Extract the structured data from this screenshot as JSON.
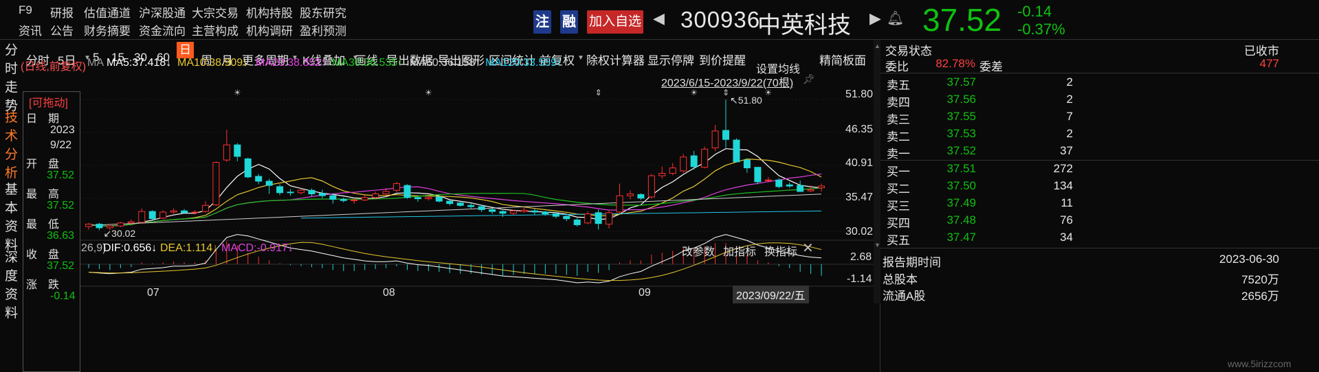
{
  "nav_row1": [
    "F9",
    "研报",
    "估值通道",
    "沪深股通",
    "大宗交易",
    "机构持股",
    "股东研究"
  ],
  "nav_row2": [
    "资讯",
    "公告",
    "财务摘要",
    "资金流向",
    "主营构成",
    "机构调研",
    "盈利预测"
  ],
  "header": {
    "zhu": "注",
    "rong": "融",
    "add_watch": "加入自选",
    "code": "300936",
    "name": "中英科技",
    "price": "37.52",
    "change": "-0.14",
    "change_pct": "-0.37%"
  },
  "toolbar": [
    "分时",
    "5日",
    "5",
    "15",
    "30",
    "60",
    "日",
    "周",
    "月",
    "更多周期",
    "K线叠加",
    "画线",
    "导出数据",
    "导出图形",
    "区间统计",
    "前复权",
    "除权计算器",
    "显示停牌",
    "到价提醒"
  ],
  "panel_toggle": "精简板面",
  "left_tabs": [
    [
      "分",
      "时",
      "走",
      "势"
    ],
    [
      "技",
      "术",
      "分",
      "析"
    ],
    [
      "基",
      "本",
      "资",
      "料"
    ],
    [
      "深",
      "度",
      "资",
      "料"
    ]
  ],
  "ma": {
    "prefix": "(日线,前复权)",
    "label": "MA",
    "ma5": "MA5:37.418↓",
    "ma10": "MA10:38.909↓",
    "ma20": "MA20:38.352↑",
    "ma30": "MA30:36.535↑",
    "ma60": "MA60:36.158↑",
    "ma120": "MA120:33.559↑"
  },
  "ma_setting": "设置均线",
  "range": "2023/6/15-2023/9/22(70根)",
  "info": {
    "drag": "[可拖动]",
    "date_label": "日　期",
    "year": "2023",
    "day": "9/22",
    "open_label": "开　盘",
    "open": "37.52",
    "high_label": "最　高",
    "high": "37.52",
    "low_label": "最　低",
    "low": "36.63",
    "close_label": "收　盘",
    "close": "37.52",
    "chg_label": "涨　跌",
    "chg": "-0.14"
  },
  "price_axis": [
    "51.80",
    "46.35",
    "40.91",
    "35.47",
    "30.02"
  ],
  "annot_high": "51.80",
  "annot_low": "30.02",
  "macd": {
    "params": "26,9)",
    "dif": "DIF:0.656↓",
    "dea": "DEA:1.114↓",
    "macd": "MACD:-0.917↓",
    "btn1": "改参数",
    "btn2": "加指标",
    "btn3": "换指标",
    "axis_top": "2.68",
    "axis_bot": "-1.14"
  },
  "months": [
    "07",
    "08",
    "09"
  ],
  "cursor_date": "2023/09/22/五",
  "right": {
    "status_label": "交易状态",
    "status": "已收市",
    "ratio_label": "委比",
    "ratio": "82.78%",
    "diff_label": "委差",
    "diff": "477",
    "asks": [
      [
        "卖五",
        "37.57",
        "2"
      ],
      [
        "卖四",
        "37.56",
        "2"
      ],
      [
        "卖三",
        "37.55",
        "7"
      ],
      [
        "卖二",
        "37.53",
        "2"
      ],
      [
        "卖一",
        "37.52",
        "37"
      ]
    ],
    "bids": [
      [
        "买一",
        "37.51",
        "272"
      ],
      [
        "买二",
        "37.50",
        "134"
      ],
      [
        "买三",
        "37.49",
        "11"
      ],
      [
        "买四",
        "37.48",
        "76"
      ],
      [
        "买五",
        "37.47",
        "34"
      ]
    ],
    "report_label": "报告期时间",
    "report": "2023-06-30",
    "total_label": "总股本",
    "total": "7520万",
    "float_label": "流通A股",
    "float": "2656万"
  },
  "watermark": "www.5irizzcom",
  "colors": {
    "up": "#ff3030",
    "down": "#20d8d8",
    "ma5": "#ffffff",
    "ma10": "#e8c832",
    "ma20": "#e040e0",
    "ma30": "#20c020",
    "ma60": "#d0d0d0",
    "ma120": "#20c8e8"
  },
  "candles": [
    [
      30.8,
      31.2,
      30.3,
      31.4
    ],
    [
      31.2,
      30.6,
      30.2,
      31.4
    ],
    [
      30.6,
      30.9,
      30.2,
      31.2
    ],
    [
      30.9,
      31.4,
      30.7,
      31.6
    ],
    [
      31.4,
      31.6,
      31.2,
      32
    ],
    [
      31.5,
      33.3,
      31.4,
      33.8
    ],
    [
      33.3,
      32.1,
      31.9,
      33.5
    ],
    [
      32.2,
      33.2,
      32,
      33.5
    ],
    [
      33.2,
      33.4,
      32.9,
      33.8
    ],
    [
      33.4,
      33.1,
      32.9,
      33.7
    ],
    [
      33.1,
      33.2,
      32.8,
      33.5
    ],
    [
      33.3,
      34.3,
      33.1,
      35
    ],
    [
      34.4,
      41.4,
      34.2,
      41.6
    ],
    [
      41.8,
      44.3,
      41.5,
      46.8
    ],
    [
      44.3,
      42.4,
      41.6,
      44.6
    ],
    [
      42,
      39,
      38.8,
      42.2
    ],
    [
      39.1,
      38.3,
      37.8,
      39.5
    ],
    [
      38.3,
      37.6,
      36.2,
      38.7
    ],
    [
      37.4,
      36.4,
      36,
      37.8
    ],
    [
      36.5,
      36.4,
      35.9,
      37
    ],
    [
      36.4,
      36.8,
      36.1,
      37.1
    ],
    [
      36.8,
      36.2,
      35.8,
      37.1
    ],
    [
      36.3,
      35.9,
      35.5,
      36.9
    ],
    [
      35.9,
      35.3,
      34.6,
      36.3
    ],
    [
      35.3,
      35.1,
      34.8,
      35.6
    ],
    [
      35.1,
      35.2,
      34.6,
      35.5
    ],
    [
      35.2,
      35.6,
      35,
      36
    ],
    [
      35.6,
      36.2,
      35.3,
      36.6
    ],
    [
      36.2,
      36.6,
      35.9,
      37.2
    ],
    [
      36.8,
      37.9,
      36.5,
      38.2
    ],
    [
      37.6,
      35.6,
      35.4,
      37.8
    ],
    [
      35.6,
      35.4,
      34.9,
      35.8
    ],
    [
      35.4,
      35.6,
      35.1,
      36.1
    ],
    [
      35.7,
      35,
      34.8,
      36
    ],
    [
      35,
      34.6,
      34.3,
      35.2
    ],
    [
      34.7,
      34.3,
      34.1,
      35
    ],
    [
      34.3,
      34.1,
      33.8,
      34.7
    ],
    [
      34.1,
      33.6,
      33.2,
      34.4
    ],
    [
      33.6,
      33.3,
      32.9,
      33.9
    ],
    [
      33.3,
      33,
      32.4,
      33.5
    ],
    [
      33,
      33.4,
      32.7,
      33.6
    ],
    [
      33.3,
      33.5,
      33.1,
      33.9
    ],
    [
      33.4,
      33.2,
      32.8,
      33.8
    ],
    [
      33.2,
      32.9,
      32.6,
      33.4
    ],
    [
      32.9,
      32.5,
      32.2,
      33.2
    ],
    [
      32.5,
      32.1,
      31.7,
      32.7
    ],
    [
      31.9,
      31.1,
      30.8,
      32.2
    ],
    [
      31.4,
      32.9,
      31.2,
      33.3
    ],
    [
      33.1,
      31.3,
      30.3,
      33.6
    ],
    [
      31.2,
      33.1,
      30.5,
      33.4
    ],
    [
      33.2,
      35.9,
      33,
      37.9
    ],
    [
      35.9,
      36.2,
      35.3,
      36.8
    ],
    [
      36.1,
      35.5,
      35.2,
      36.3
    ],
    [
      35.7,
      39.2,
      35.4,
      39.5
    ],
    [
      39.2,
      39.6,
      38.7,
      40.7
    ],
    [
      39.6,
      40.5,
      39.3,
      41.3
    ],
    [
      40,
      42.3,
      39.7,
      42.8
    ],
    [
      42.5,
      40.7,
      40.2,
      43.3
    ],
    [
      40.6,
      43.6,
      40.4,
      44
    ],
    [
      43.8,
      46.6,
      43.3,
      47.6
    ],
    [
      46.7,
      45.2,
      43.8,
      51.8
    ],
    [
      45.1,
      41.5,
      41.4,
      45.4
    ],
    [
      41.8,
      40.5,
      39.7,
      42
    ],
    [
      40.6,
      38.2,
      37.8,
      40.6
    ],
    [
      38.4,
      38.5,
      38.1,
      39
    ],
    [
      38.5,
      37.4,
      37.1,
      38.8
    ],
    [
      37.7,
      37.5,
      37.2,
      38.1
    ],
    [
      37.6,
      36.6,
      36.6,
      38.4
    ],
    [
      36.7,
      36.9,
      36.5,
      37.6
    ],
    [
      37.2,
      37.5,
      36.6,
      37.9
    ]
  ],
  "macd_bars": [
    -0.2,
    -0.25,
    -0.3,
    -0.2,
    -0.15,
    0.1,
    0.05,
    0.1,
    0.15,
    0.1,
    0.1,
    0.2,
    0.8,
    1.2,
    1.0,
    0.6,
    0.4,
    0.2,
    0.05,
    -0.05,
    -0.1,
    -0.15,
    -0.2,
    -0.3,
    -0.35,
    -0.35,
    -0.3,
    -0.25,
    -0.2,
    -0.1,
    -0.3,
    -0.35,
    -0.35,
    -0.4,
    -0.45,
    -0.5,
    -0.5,
    -0.55,
    -0.55,
    -0.6,
    -0.55,
    -0.5,
    -0.5,
    -0.5,
    -0.5,
    -0.55,
    -0.6,
    -0.4,
    -0.45,
    -0.3,
    0.1,
    0.2,
    0.2,
    0.5,
    0.6,
    0.7,
    0.9,
    0.8,
    0.9,
    1.1,
    1.1,
    0.7,
    0.5,
    0.2,
    0.1,
    -0.1,
    -0.2,
    -0.4,
    -0.5,
    -0.6
  ],
  "dif_line": [
    -0.3,
    -0.35,
    -0.4,
    -0.35,
    -0.3,
    -0.1,
    -0.05,
    0,
    0.1,
    0.1,
    0.15,
    0.3,
    1.2,
    2.0,
    2.2,
    2.1,
    1.9,
    1.7,
    1.5,
    1.3,
    1.2,
    1.1,
    0.95,
    0.8,
    0.65,
    0.55,
    0.45,
    0.4,
    0.4,
    0.45,
    0.3,
    0.2,
    0.15,
    0.05,
    -0.05,
    -0.15,
    -0.25,
    -0.35,
    -0.45,
    -0.55,
    -0.6,
    -0.65,
    -0.7,
    -0.75,
    -0.8,
    -0.9,
    -1.0,
    -0.95,
    -1.0,
    -0.9,
    -0.6,
    -0.4,
    -0.25,
    0.1,
    0.4,
    0.7,
    1.1,
    1.3,
    1.6,
    2.0,
    2.2,
    2.0,
    1.8,
    1.5,
    1.3,
    1.1,
    0.95,
    0.8,
    0.7,
    0.65
  ]
}
